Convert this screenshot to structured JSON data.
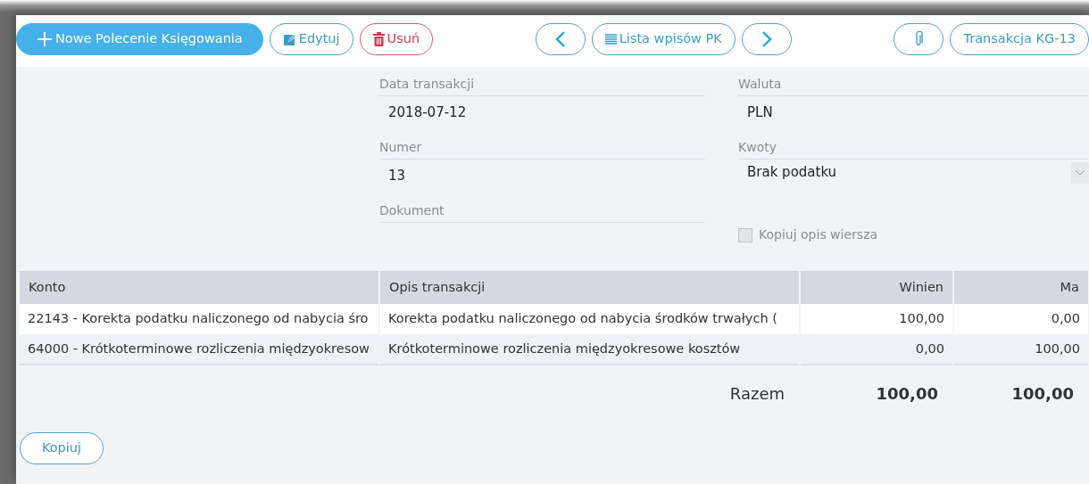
{
  "toolbar": {
    "buttons": [
      {
        "kind": "primary",
        "label": "Nowe Polecenie Księgowania"
      },
      {
        "kind": "outline",
        "label": "Edytuj"
      },
      {
        "kind": "danger",
        "label": "Usuń"
      },
      {
        "kind": "spacer"
      },
      {
        "kind": "outline"
      },
      {
        "kind": "outline",
        "label": "Lista wpisów PK"
      },
      {
        "kind": "outline"
      },
      {
        "kind": "spacer"
      },
      {
        "kind": "outline"
      },
      {
        "kind": "outline",
        "label": "Transakcja KG-13"
      }
    ]
  },
  "form": {
    "fields": [
      {
        "kind": "text",
        "label": "Data transakcji",
        "value": "2018-07-12"
      },
      {
        "kind": "text",
        "label": "Waluta",
        "value": "PLN"
      },
      {
        "kind": "text",
        "label": "Numer",
        "value": "13"
      },
      {
        "kind": "select",
        "label": "Kwoty",
        "value": "Brak podatku"
      },
      {
        "kind": "text",
        "label": "Dokument"
      },
      {
        "kind": "checkbox",
        "label": "Kopiuj opis wiersza",
        "checked": false,
        "disabled": true
      }
    ]
  },
  "table": {
    "columns": [
      "Konto",
      "Opis transakcji",
      "Winien",
      "Ma"
    ],
    "rows": [
      [
        "22143 - Korekta podatku naliczonego od nabycia śro",
        "Korekta podatku naliczonego od nabycia środków trwałych (",
        "100,00",
        "0,00"
      ],
      [
        "64000 - Krótkoterminowe rozliczenia międzyokresow",
        "Krótkoterminowe rozliczenia międzyokresowe kosztów",
        "0,00",
        "100,00"
      ]
    ],
    "totals": {
      "label": "Razem",
      "debit": "100,00",
      "credit": "100,00"
    }
  },
  "footer": {
    "buttons": [
      "Kopiuj"
    ]
  }
}
